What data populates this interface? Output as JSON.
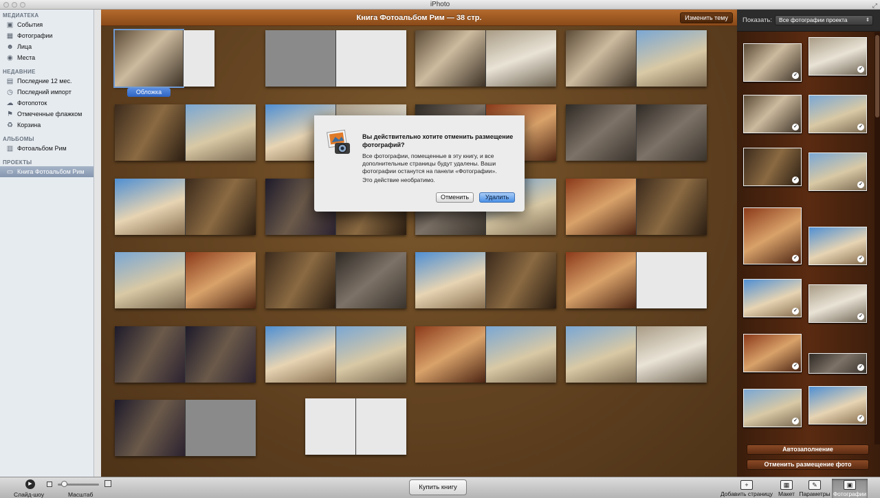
{
  "window": {
    "title": "iPhoto"
  },
  "sidebar": {
    "library": {
      "heading": "МЕДИАТЕКА",
      "items": [
        {
          "label": "События",
          "icon": "events-icon"
        },
        {
          "label": "Фотографии",
          "icon": "photos-icon"
        },
        {
          "label": "Лица",
          "icon": "faces-icon"
        },
        {
          "label": "Места",
          "icon": "places-icon"
        }
      ]
    },
    "recent": {
      "heading": "НЕДАВНИЕ",
      "items": [
        {
          "label": "Последние 12 мес.",
          "icon": "calendar-icon"
        },
        {
          "label": "Последний импорт",
          "icon": "import-icon"
        },
        {
          "label": "Фотопоток",
          "icon": "photostream-icon"
        },
        {
          "label": "Отмеченные флажком",
          "icon": "flag-icon"
        },
        {
          "label": "Корзина",
          "icon": "trash-icon"
        }
      ]
    },
    "albums": {
      "heading": "АЛЬБОМЫ",
      "items": [
        {
          "label": "Фотоальбом Рим",
          "icon": "album-icon"
        }
      ]
    },
    "projects": {
      "heading": "ПРОЕКТЫ",
      "items": [
        {
          "label": "Книга Фотоальбом Рим",
          "icon": "book-icon",
          "selected": true
        }
      ]
    }
  },
  "main": {
    "book_title": "Книга Фотоальбом Рим — 38 стр.",
    "change_theme_label": "Изменить тему",
    "cover_label": "Обложка"
  },
  "dialog": {
    "title": "Вы действительно хотите отменить размещение фотографий?",
    "body": "Все фотографии, помещенные в эту книгу, и все дополнительные страницы будут удалены. Ваши фотографии останутся на панели «Фотографии».",
    "note": "Это действие необратимо.",
    "cancel_label": "Отменить",
    "delete_label": "Удалить"
  },
  "right_panel": {
    "show_label": "Показать:",
    "show_value": "Все фотографии проекта",
    "autofill_label": "Автозаполнение",
    "unplace_label": "Отменить размещение фото"
  },
  "toolbar": {
    "slideshow_label": "Слайд-шоу",
    "zoom_label": "Масштаб",
    "zoom_level": 0.1,
    "buy_book_label": "Купить книгу",
    "add_page_label": "Добавить страницу",
    "layout_label": "Макет",
    "options_label": "Параметры",
    "photos_label": "Фотографии"
  },
  "colors": {
    "accent_blue": "#4b90e6",
    "wood_brown": "#654522",
    "sidebar_bg": "#e6ebf0"
  }
}
